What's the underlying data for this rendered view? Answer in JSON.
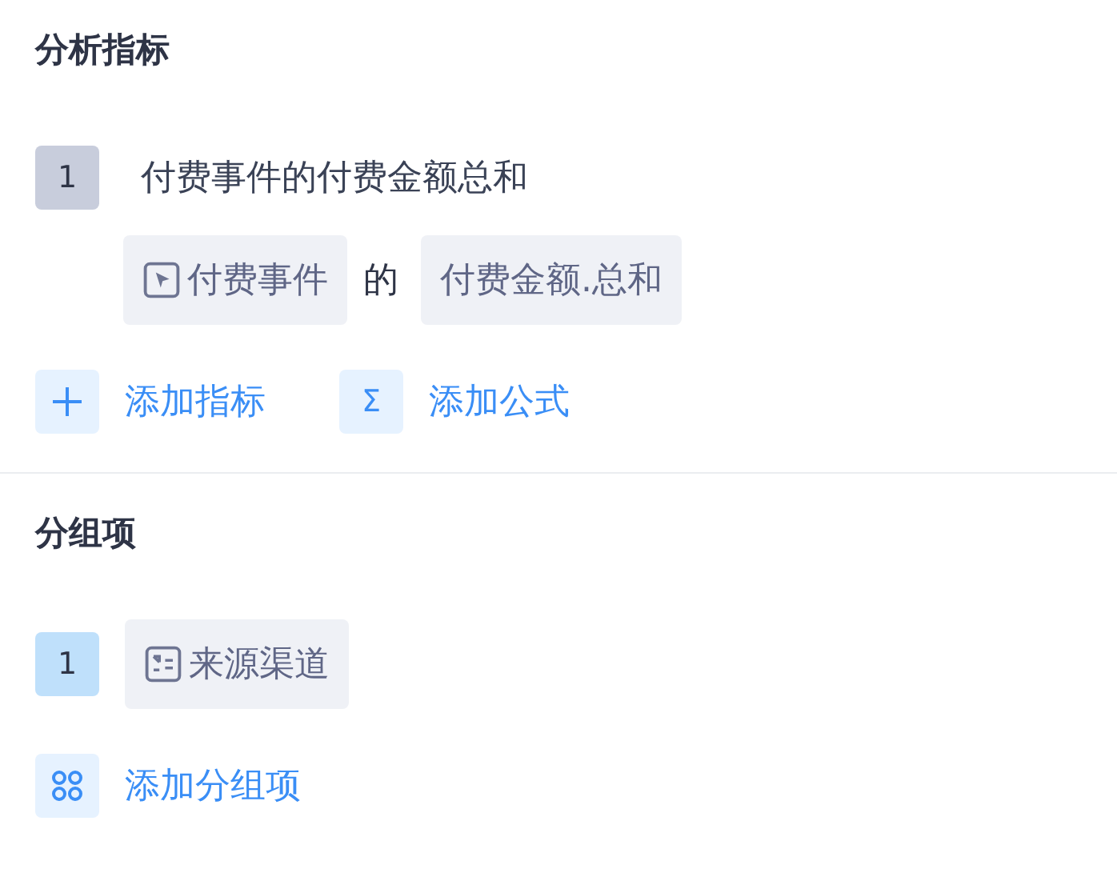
{
  "metrics": {
    "title": "分析指标",
    "items": [
      {
        "index": "1",
        "name": "付费事件的付费金额总和",
        "event": "付费事件",
        "connector": "的",
        "property": "付费金额.总和"
      }
    ],
    "actions": [
      {
        "kind": "plus",
        "label": "添加指标"
      },
      {
        "kind": "symbol",
        "symbol": "Σ",
        "label": "添加公式"
      }
    ]
  },
  "groups": {
    "title": "分组项",
    "items": [
      {
        "index": "1",
        "name": "来源渠道"
      }
    ],
    "actions": [
      {
        "kind": "grid",
        "label": "添加分组项"
      }
    ]
  }
}
